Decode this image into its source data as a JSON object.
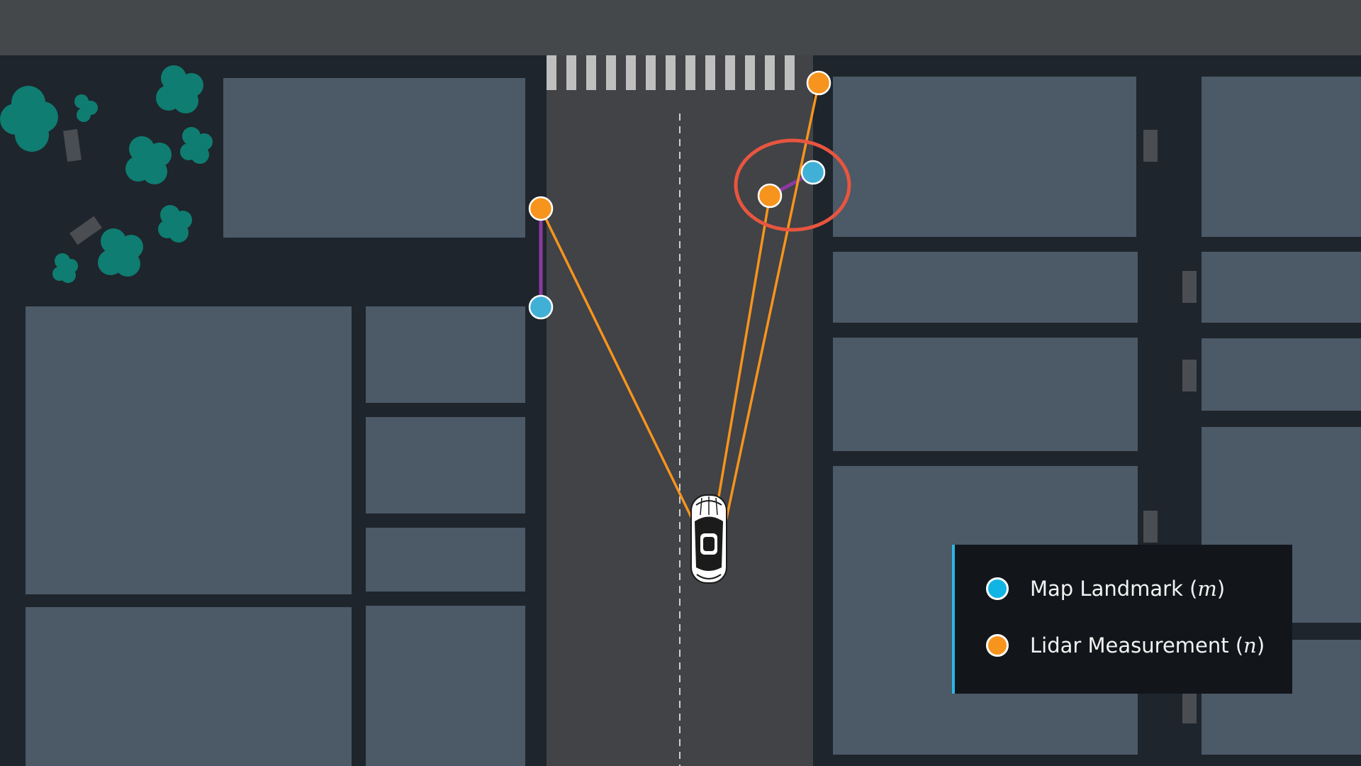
{
  "colors": {
    "ground": "#1e252c",
    "top_band": "#45484b",
    "building": "#4c5967",
    "road": "#414346",
    "crosswalk": "#bfbfbf",
    "tree": "#0f7d71",
    "map_landmark": "#41b0d6",
    "lidar_measurement": "#f7941d",
    "association_line": "#f7941d",
    "error_line": "#8a3aa0",
    "highlight_ring": "#e8553f",
    "legend_accent": "#29b7e6"
  },
  "legend": {
    "items": [
      {
        "label_prefix": "Map Landmark (",
        "variable": "m",
        "label_suffix": ")",
        "color": "#12b4e3",
        "marker": "map-landmark"
      },
      {
        "label_prefix": "Lidar Measurement (",
        "variable": "n",
        "label_suffix": ")",
        "color": "#f7941d",
        "marker": "lidar-measurement"
      }
    ]
  }
}
